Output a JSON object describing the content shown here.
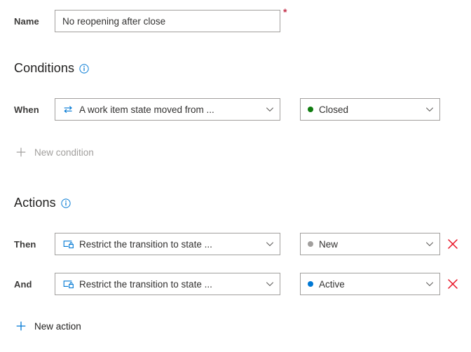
{
  "form": {
    "name_row": {
      "label": "Name",
      "value": "No reopening after close",
      "placeholder": "",
      "required_marker": "*"
    },
    "conditions": {
      "heading": "Conditions",
      "info_icon": "info-circle-icon",
      "rows": [
        {
          "label": "When",
          "rule_icon": "state-transition-icon",
          "rule_text": "A work item state moved from ...",
          "state_text": "Closed",
          "state_color": "#107c10",
          "chevron_icon": "chevron-down-icon"
        }
      ],
      "new_button": {
        "label": "New condition",
        "icon": "plus-icon",
        "enabled": false
      }
    },
    "actions": {
      "heading": "Actions",
      "info_icon": "info-circle-icon",
      "rows": [
        {
          "label": "Then",
          "rule_icon": "restrict-transition-lock-icon",
          "rule_text": "Restrict the transition to state ...",
          "state_text": "New",
          "state_color": "#a19f9d",
          "chevron_icon": "chevron-down-icon",
          "delete_icon": "close-x-icon"
        },
        {
          "label": "And",
          "rule_icon": "restrict-transition-lock-icon",
          "rule_text": "Restrict the transition to state ...",
          "state_text": "Active",
          "state_color": "#0078d4",
          "chevron_icon": "chevron-down-icon",
          "delete_icon": "close-x-icon"
        }
      ],
      "new_button": {
        "label": "New action",
        "icon": "plus-icon",
        "enabled": true
      }
    }
  },
  "colors": {
    "accent_blue": "#0078d4",
    "border_gray": "#a19f9d",
    "text_dark": "#201f1e",
    "text_disabled": "#a19f9d",
    "required_red": "#c4314b",
    "delete_red": "#e81123",
    "state_closed_green": "#107c10",
    "state_new_gray": "#a19f9d",
    "state_active_blue": "#0078d4"
  }
}
